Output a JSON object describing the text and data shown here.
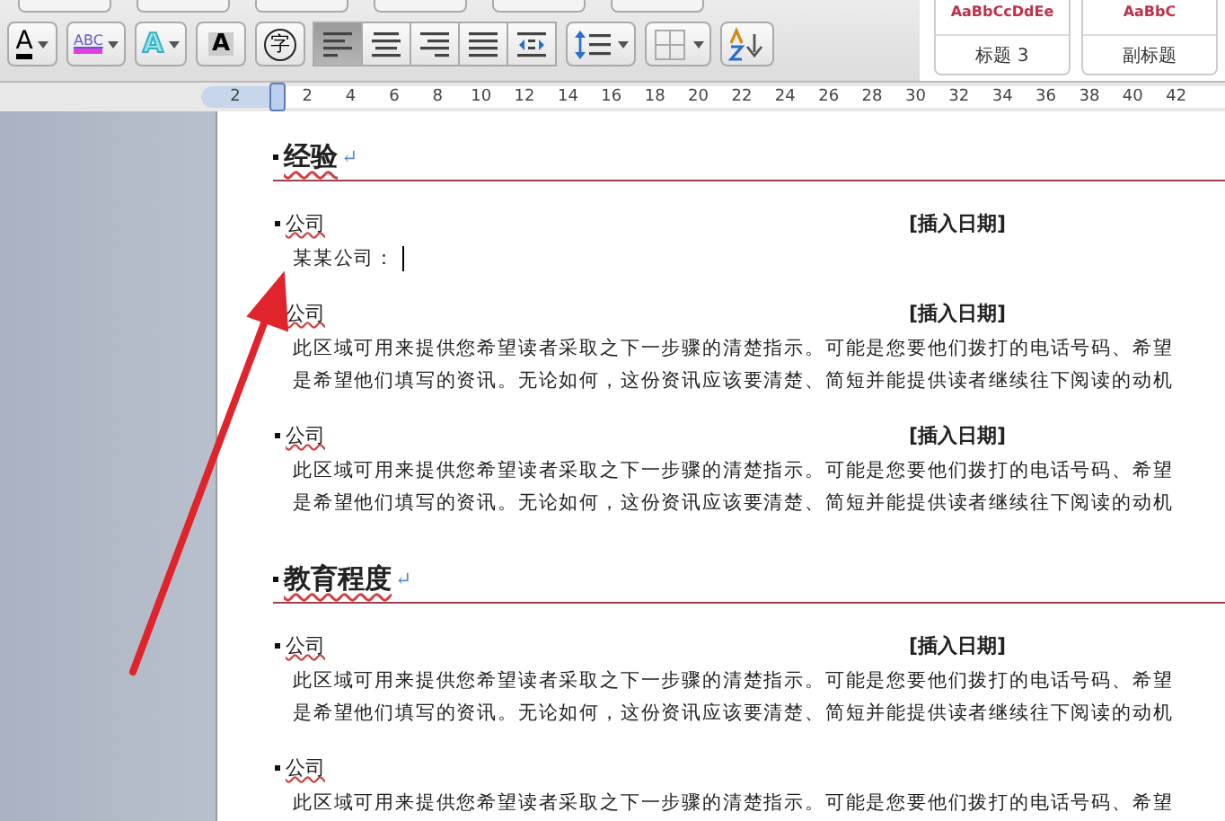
{
  "toolbar": {
    "buttons": [
      {
        "kind": "font-color",
        "glyph": "A",
        "menu": true
      },
      {
        "kind": "highlight",
        "glyph": "ABC",
        "menu": true
      },
      {
        "kind": "text-effects",
        "glyph": "A",
        "menu": true
      },
      {
        "kind": "char-shading",
        "glyph": "A",
        "menu": false
      },
      {
        "kind": "enclosed",
        "glyph": "字",
        "menu": false
      },
      {
        "kind": "align-left",
        "selected": true
      },
      {
        "kind": "align-center",
        "selected": false
      },
      {
        "kind": "align-right",
        "selected": false
      },
      {
        "kind": "justify",
        "selected": false
      },
      {
        "kind": "distribute",
        "selected": false
      },
      {
        "kind": "line-spacing",
        "menu": true
      },
      {
        "kind": "borders",
        "menu": true
      },
      {
        "kind": "sort",
        "menu": false
      }
    ]
  },
  "styles": [
    {
      "preview": "AaBbCcDdEe",
      "label": "标题 3"
    },
    {
      "preview": "AaBbC",
      "label": "副标题"
    }
  ],
  "ruler": {
    "labels": [
      "2",
      "2",
      "4",
      "6",
      "8",
      "10",
      "12",
      "14",
      "16",
      "18",
      "20",
      "22",
      "24",
      "26",
      "28",
      "30",
      "32",
      "34",
      "36",
      "38",
      "40",
      "42"
    ]
  },
  "document": {
    "sections": [
      {
        "heading": "经验",
        "mark": "↵",
        "entries": [
          {
            "company": "公司",
            "date": "[插入日期]",
            "lines": [
              "某某公司："
            ],
            "cursor": true
          },
          {
            "company": "公司",
            "date": "[插入日期]",
            "lines": [
              "此区域可用来提供您希望读者采取之下一步骤的清楚指示。可能是您要他们拨打的电话号码、希望",
              "是希望他们填写的资讯。无论如何，这份资讯应该要清楚、简短并能提供读者继续往下阅读的动机"
            ],
            "cursor": false
          },
          {
            "company": "公司",
            "date": "[插入日期]",
            "lines": [
              "此区域可用来提供您希望读者采取之下一步骤的清楚指示。可能是您要他们拨打的电话号码、希望",
              "是希望他们填写的资讯。无论如何，这份资讯应该要清楚、简短并能提供读者继续往下阅读的动机"
            ],
            "cursor": false
          }
        ]
      },
      {
        "heading": "教育程度",
        "mark": "↵",
        "entries": [
          {
            "company": "公司",
            "date": "[插入日期]",
            "lines": [
              "此区域可用来提供您希望读者采取之下一步骤的清楚指示。可能是您要他们拨打的电话号码、希望",
              "是希望他们填写的资讯。无论如何，这份资讯应该要清楚、简短并能提供读者继续往下阅读的动机"
            ],
            "cursor": false
          },
          {
            "company": "公司",
            "lines": [
              "此区域可用来提供您希望读者采取之下一步骤的清楚指示。可能是您要他们拨打的电话号码、希望"
            ],
            "cursor": false
          }
        ]
      }
    ]
  }
}
